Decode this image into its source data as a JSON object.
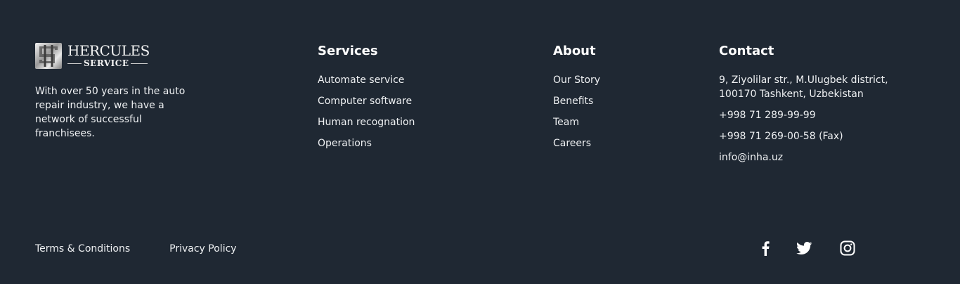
{
  "brand": {
    "logo_title": "HERCULES",
    "logo_subtitle": "SERVICE",
    "description": "With over 50 years in the auto repair industry, we have a network of successful franchisees."
  },
  "services": {
    "heading": "Services",
    "items": [
      {
        "label": "Automate service"
      },
      {
        "label": "Computer software"
      },
      {
        "label": "Human recognation"
      },
      {
        "label": "Operations"
      }
    ]
  },
  "about": {
    "heading": "About",
    "items": [
      {
        "label": "Our Story"
      },
      {
        "label": "Benefits"
      },
      {
        "label": "Team"
      },
      {
        "label": "Careers"
      }
    ]
  },
  "contact": {
    "heading": "Contact",
    "address": "9, Ziyolilar str., M.Ulugbek district, 100170 Tashkent, Uzbekistan",
    "phone": "+998 71 289-99-99",
    "fax": "+998 71 269-00-58 (Fax)",
    "email": "info@inha.uz"
  },
  "legal": {
    "terms": "Terms & Conditions",
    "privacy": "Privacy Policy"
  },
  "social": {
    "icons": [
      "facebook-icon",
      "twitter-icon",
      "instagram-icon"
    ]
  },
  "colors": {
    "background": "#1f2833",
    "text": "#ffffff"
  }
}
